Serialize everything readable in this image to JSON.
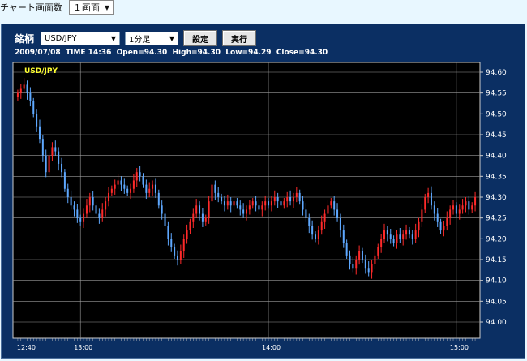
{
  "top": {
    "label": "チャート画面数",
    "screens_value": "１画面"
  },
  "panel": {
    "symbol_label": "銘柄",
    "symbol_value": "USD/JPY",
    "interval_value": "1分足",
    "settings_button": "設定",
    "run_button": "実行",
    "info": {
      "date": "2009/07/08",
      "time": "TIME 14:36",
      "open": "Open=94.30",
      "high": "High=94.30",
      "low": "Low=94.29",
      "close": "Close=94.30"
    }
  },
  "colors": {
    "panel_bg": "#0b2f63",
    "up": "#ff2a2a",
    "down": "#5ea8ff",
    "grid": "#9a9a9a",
    "chart_bg": "#000000",
    "symbol_label_color": "#ffff33"
  },
  "chart_data": {
    "type": "candlestick",
    "symbol_label": "USD/JPY",
    "ylim": [
      94.0,
      94.6
    ],
    "yticks": [
      "94.60",
      "94.55",
      "94.50",
      "94.45",
      "94.40",
      "94.35",
      "94.30",
      "94.25",
      "94.20",
      "94.15",
      "94.10",
      "94.05",
      "94.00"
    ],
    "xtick_labels": [
      "12:40",
      "13:00",
      "14:00",
      "15:00"
    ],
    "xtick_index": [
      0,
      20,
      80,
      140
    ],
    "close_path": [
      94.55,
      94.56,
      94.57,
      94.55,
      94.53,
      94.5,
      94.47,
      94.44,
      94.4,
      94.36,
      94.4,
      94.42,
      94.41,
      94.38,
      94.36,
      94.32,
      94.3,
      94.28,
      94.27,
      94.25,
      94.24,
      94.26,
      94.28,
      94.3,
      94.28,
      94.26,
      94.25,
      94.27,
      94.29,
      94.31,
      94.32,
      94.33,
      94.34,
      94.33,
      94.32,
      94.31,
      94.32,
      94.34,
      94.36,
      94.35,
      94.33,
      94.31,
      94.32,
      94.33,
      94.31,
      94.28,
      94.26,
      94.23,
      94.2,
      94.18,
      94.16,
      94.15,
      94.17,
      94.2,
      94.22,
      94.24,
      94.26,
      94.28,
      94.26,
      94.24,
      94.25,
      94.29,
      94.33,
      94.31,
      94.3,
      94.29,
      94.28,
      94.29,
      94.28,
      94.29,
      94.28,
      94.27,
      94.26,
      94.27,
      94.28,
      94.29,
      94.28,
      94.27,
      94.28,
      94.29,
      94.28,
      94.29,
      94.3,
      94.29,
      94.28,
      94.29,
      94.3,
      94.29,
      94.3,
      94.31,
      94.29,
      94.27,
      94.25,
      94.23,
      94.21,
      94.2,
      94.22,
      94.24,
      94.26,
      94.28,
      94.29,
      94.27,
      94.25,
      94.22,
      94.19,
      94.16,
      94.14,
      94.13,
      94.15,
      94.17,
      94.15,
      94.13,
      94.12,
      94.14,
      94.16,
      94.18,
      94.2,
      94.22,
      94.21,
      94.2,
      94.19,
      94.21,
      94.2,
      94.21,
      94.22,
      94.21,
      94.2,
      94.22,
      94.24,
      94.27,
      94.3,
      94.31,
      94.28,
      94.26,
      94.24,
      94.22,
      94.23,
      94.25,
      94.27,
      94.28,
      94.26,
      94.27,
      94.28,
      94.29,
      94.27,
      94.28,
      94.3
    ]
  }
}
